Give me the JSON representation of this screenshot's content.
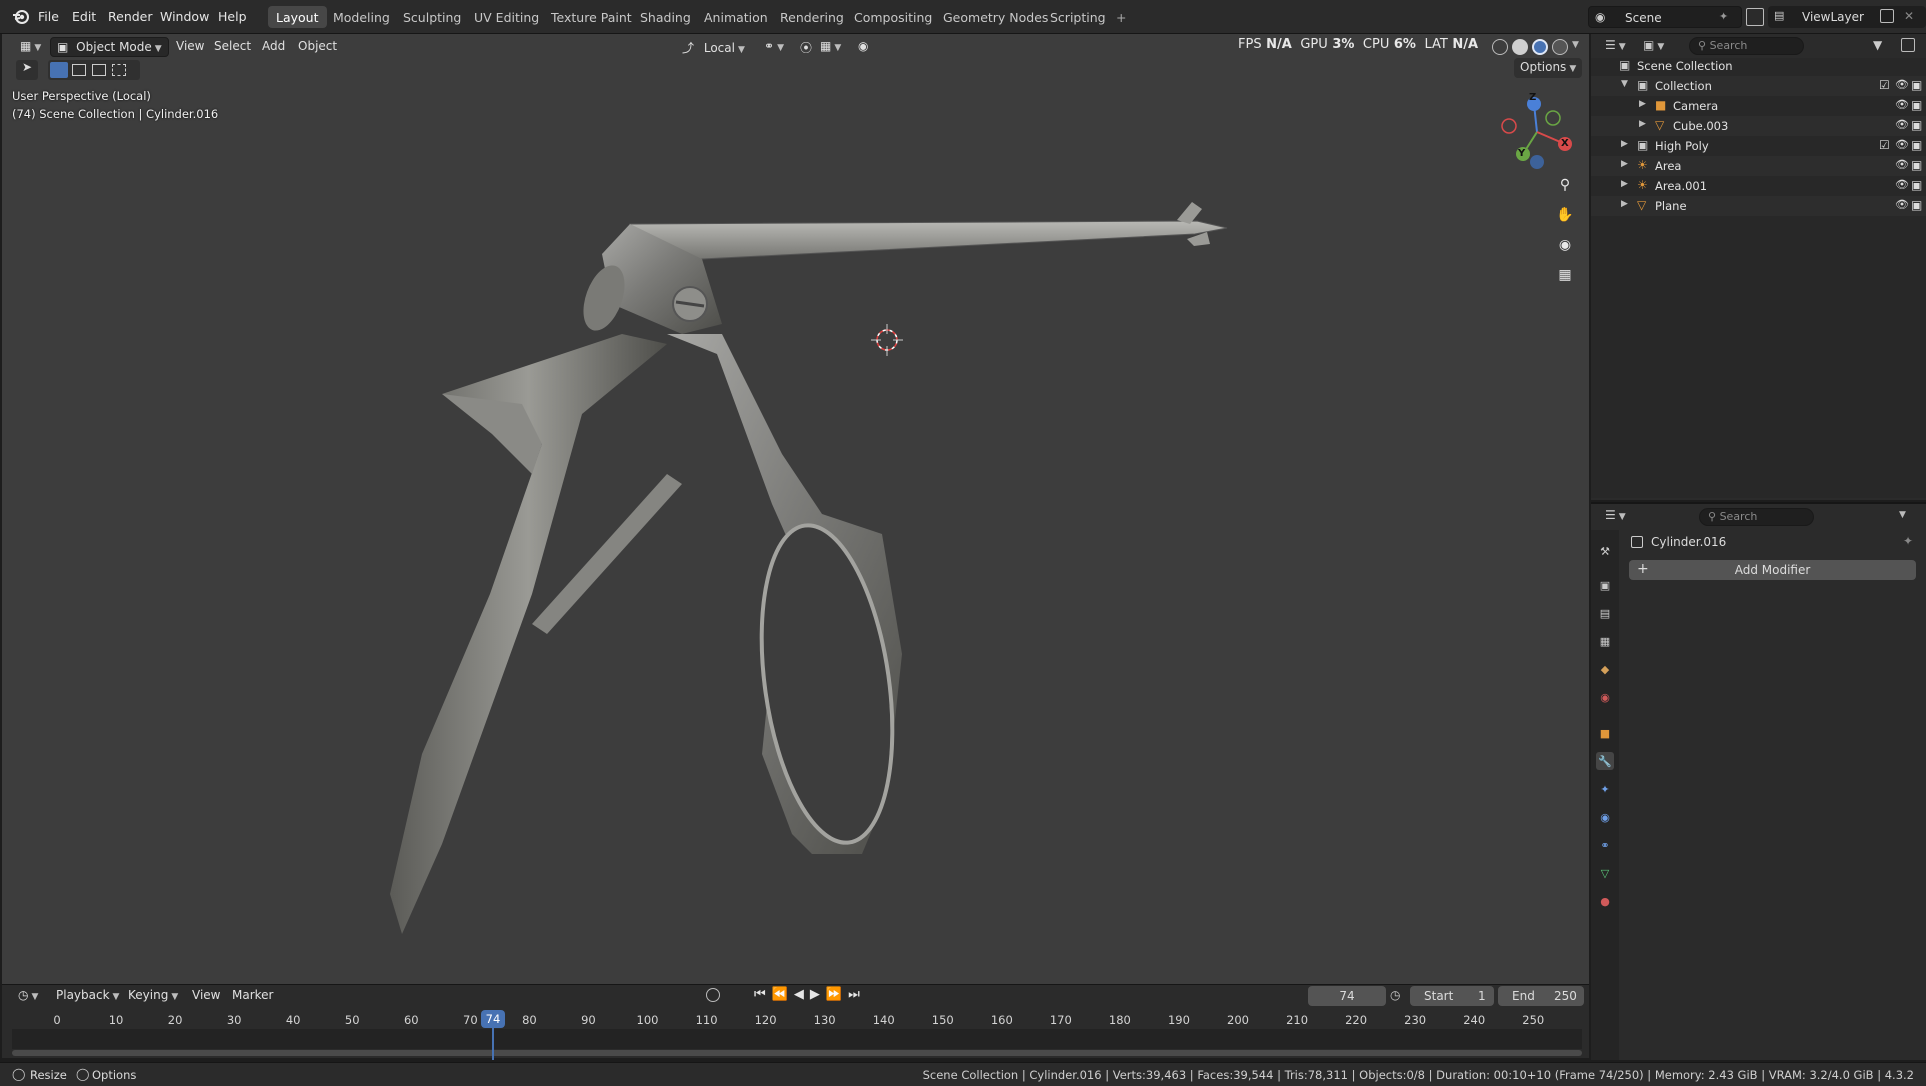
{
  "menu": [
    "File",
    "Edit",
    "Render",
    "Window",
    "Help"
  ],
  "workspaces": [
    {
      "label": "Layout",
      "active": true
    },
    {
      "label": "Modeling",
      "active": false
    },
    {
      "label": "Sculpting",
      "active": false
    },
    {
      "label": "UV Editing",
      "active": false
    },
    {
      "label": "Texture Paint",
      "active": false
    },
    {
      "label": "Shading",
      "active": false
    },
    {
      "label": "Animation",
      "active": false
    },
    {
      "label": "Rendering",
      "active": false
    },
    {
      "label": "Compositing",
      "active": false
    },
    {
      "label": "Geometry Nodes",
      "active": false
    },
    {
      "label": "Scripting",
      "active": false
    }
  ],
  "add_workspace": "+",
  "scene": {
    "name": "Scene",
    "view_layer": "ViewLayer"
  },
  "viewport": {
    "mode": "Object Mode",
    "menu": [
      "View",
      "Select",
      "Add",
      "Object"
    ],
    "transform_orientation": "Local",
    "options_label": "Options",
    "perspective_text": "User Perspective (Local)",
    "collection_text": "(74) Scene Collection | Cylinder.016",
    "perf": {
      "fps_label": "FPS",
      "fps_value": "N/A",
      "gpu_label": "GPU",
      "gpu_value": "3%",
      "cpu_label": "CPU",
      "cpu_value": "6%",
      "lat_label": "LAT",
      "lat_value": "N/A"
    },
    "gizmo_axes": [
      "Z",
      "Y",
      "X"
    ]
  },
  "outliner": {
    "search_placeholder": "Search",
    "rows": [
      {
        "label": "Scene Collection",
        "depth": 0,
        "icon": "collection-icon",
        "color": "#cfcfcf",
        "expand": "",
        "checkbox": false,
        "vis": false
      },
      {
        "label": "Collection",
        "depth": 1,
        "icon": "collection-icon",
        "color": "#cfcfcf",
        "expand": "v",
        "checkbox": true,
        "vis": true
      },
      {
        "label": "Camera",
        "depth": 2,
        "icon": "camera-icon",
        "color": "#e0973a",
        "expand": ">",
        "checkbox": false,
        "vis": true
      },
      {
        "label": "Cube.003",
        "depth": 2,
        "icon": "mesh-icon",
        "color": "#e0973a",
        "expand": ">",
        "checkbox": false,
        "vis": true
      },
      {
        "label": "High Poly",
        "depth": 1,
        "icon": "collection-icon",
        "color": "#cfcfcf",
        "expand": ">",
        "checkbox": true,
        "vis": true
      },
      {
        "label": "Area",
        "depth": 1,
        "icon": "light-icon",
        "color": "#e0973a",
        "expand": ">",
        "checkbox": false,
        "vis": true
      },
      {
        "label": "Area.001",
        "depth": 1,
        "icon": "light-icon",
        "color": "#e0973a",
        "expand": ">",
        "checkbox": false,
        "vis": true
      },
      {
        "label": "Plane",
        "depth": 1,
        "icon": "mesh-icon",
        "color": "#e0973a",
        "expand": ">",
        "checkbox": false,
        "vis": true
      }
    ]
  },
  "properties": {
    "search_placeholder": "Search",
    "object_name": "Cylinder.016",
    "add_modifier": "Add Modifier"
  },
  "timeline": {
    "menu": [
      "Playback",
      "Keying",
      "View",
      "Marker"
    ],
    "current_frame": "74",
    "start_label": "Start",
    "start_value": "1",
    "end_label": "End",
    "end_value": "250",
    "ticks": [
      "0",
      "10",
      "20",
      "30",
      "40",
      "50",
      "60",
      "70",
      "80",
      "90",
      "100",
      "110",
      "120",
      "130",
      "140",
      "150",
      "160",
      "170",
      "180",
      "190",
      "200",
      "210",
      "220",
      "230",
      "240",
      "250"
    ]
  },
  "statusbar": {
    "left": [
      {
        "label": "Resize"
      },
      {
        "label": "Options"
      }
    ],
    "info": "Scene Collection | Cylinder.016 | Verts:39,463 | Faces:39,544 | Tris:78,311 | Objects:0/8 | Duration: 00:10+10 (Frame 74/250) | Memory: 2.43 GiB | VRAM: 3.2/4.0 GiB | 4.3.2"
  },
  "colors": {
    "accent": "#4772b3",
    "active_object": "#e0973a",
    "viewport_bg": "#3d3d3d"
  }
}
